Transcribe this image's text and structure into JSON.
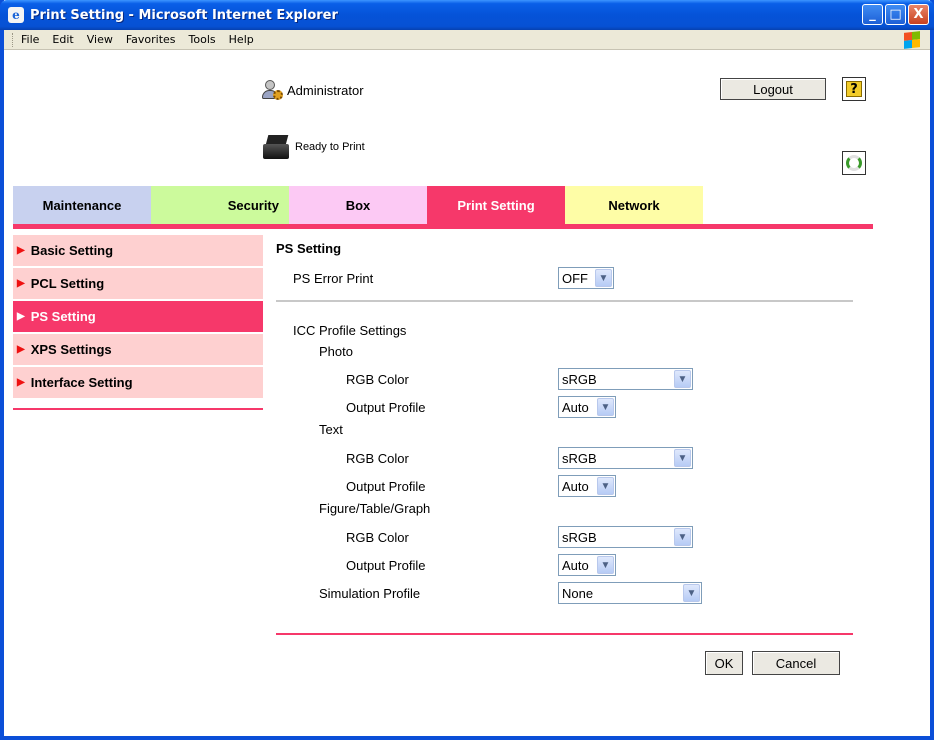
{
  "window": {
    "title": "Print Setting - Microsoft Internet Explorer",
    "controls": [
      "_",
      "□",
      "X"
    ]
  },
  "menu": [
    "File",
    "Edit",
    "View",
    "Favorites",
    "Tools",
    "Help"
  ],
  "header": {
    "user": "Administrator",
    "logout": "Logout",
    "help": "?",
    "status": "Ready to Print"
  },
  "tabs": [
    "Maintenance",
    "Security",
    "Box",
    "Print Setting",
    "Network"
  ],
  "sidebar": [
    "Basic Setting",
    "PCL Setting",
    "PS Setting",
    "XPS Settings",
    "Interface Setting"
  ],
  "main": {
    "title": "PS Setting",
    "error_print": {
      "label": "PS Error Print",
      "value": "OFF"
    },
    "icc": "ICC Profile Settings",
    "photo": {
      "label": "Photo",
      "rgb_label": "RGB Color",
      "rgb": "sRGB",
      "out_label": "Output Profile",
      "out": "Auto"
    },
    "text": {
      "label": "Text",
      "rgb_label": "RGB Color",
      "rgb": "sRGB",
      "out_label": "Output Profile",
      "out": "Auto"
    },
    "figure": {
      "label": "Figure/Table/Graph",
      "rgb_label": "RGB Color",
      "rgb": "sRGB",
      "out_label": "Output Profile",
      "out": "Auto"
    },
    "simulation": {
      "label": "Simulation Profile",
      "value": "None"
    },
    "ok": "OK",
    "cancel": "Cancel"
  },
  "colors": {
    "accent": "#f6386a",
    "sidebar_bg": "#fed0d0",
    "titlebar": "#0553d8"
  }
}
